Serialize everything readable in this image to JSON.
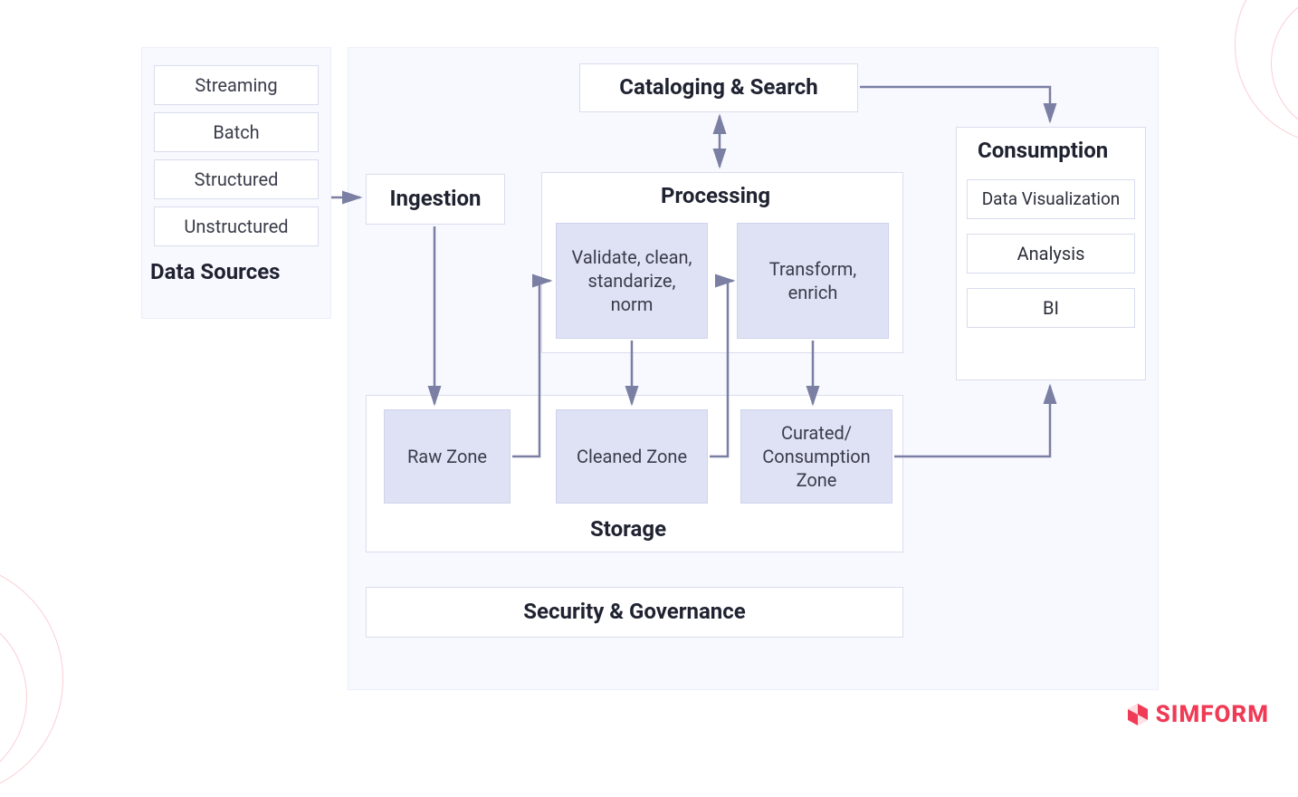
{
  "data_sources": {
    "title": "Data Sources",
    "items": [
      "Streaming",
      "Batch",
      "Structured",
      "Unstructured"
    ]
  },
  "ingestion": {
    "title": "Ingestion"
  },
  "processing": {
    "title": "Processing",
    "step1": "Validate, clean, standarize, norm",
    "step2": "Transform, enrich"
  },
  "storage": {
    "title": "Storage",
    "zones": [
      "Raw Zone",
      "Cleaned Zone",
      "Curated/ Consumption Zone"
    ]
  },
  "catalog": {
    "title": "Cataloging & Search"
  },
  "consumption": {
    "title": "Consumption",
    "items": [
      "Data Visualization",
      "Analysis",
      "BI"
    ]
  },
  "security": {
    "title": "Security & Governance"
  },
  "brand": "SIMFORM"
}
